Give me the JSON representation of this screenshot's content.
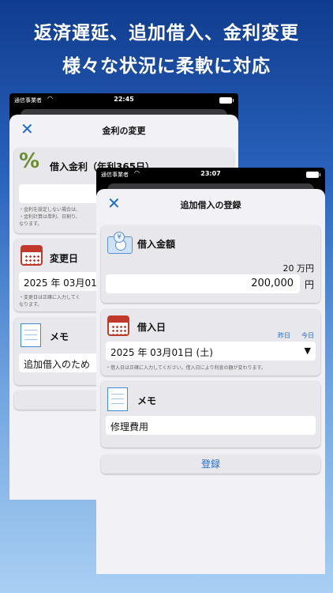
{
  "headline": {
    "line1": "返済遅延、追加借入、金利変更",
    "line2": "様々な状況に柔軟に対応"
  },
  "back_screen": {
    "status": {
      "carrier": "通信事業者",
      "time": "22:45"
    },
    "title": "金利の変更",
    "close_label": "✕",
    "rate_card": {
      "title": "借入金利（年利365日）",
      "note1": "・金利を設定しない場合は、",
      "note2": "・金利計算は単利、日割り、",
      "note3": "なります。"
    },
    "date_card": {
      "title": "変更日",
      "value": "2025 年 03月01日",
      "note1": "・変更日は正確に入力してく",
      "note2": "なります。"
    },
    "memo_card": {
      "title": "メモ",
      "value": "追加借入のため"
    }
  },
  "front_screen": {
    "status": {
      "carrier": "通信事業者",
      "time": "23:07"
    },
    "title": "追加借入の登録",
    "close_label": "✕",
    "amount_card": {
      "title": "借入金額",
      "hint": "20 万円",
      "value": "200,000",
      "unit": "円",
      "coin_label": "¥"
    },
    "date_card": {
      "title": "借入日",
      "yesterday": "昨日",
      "today": "今日",
      "value": "2025 年 03月01日 (土)",
      "dropdown": "▼",
      "note": "・借入日は正確に入力してください。借入日により利息の額が変わります。"
    },
    "memo_card": {
      "title": "メモ",
      "value": "修理費用"
    },
    "submit_label": "登録"
  }
}
